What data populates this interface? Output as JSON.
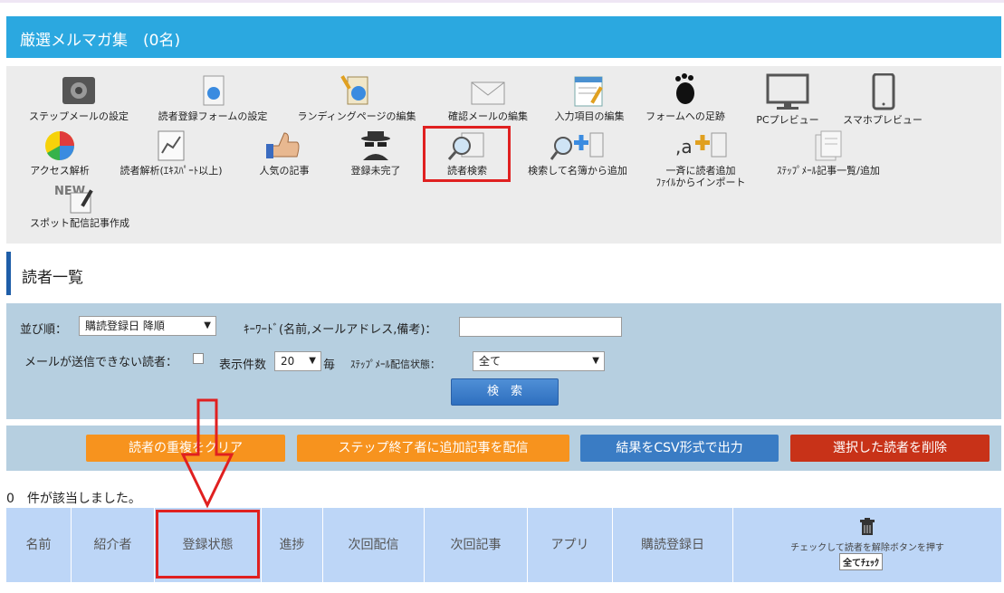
{
  "header": {
    "title": "厳選メルマガ集　(0名)",
    "color": "#2ba8e0"
  },
  "menu": [
    {
      "label": "ステップメールの設定",
      "icon": "settings-box-icon"
    },
    {
      "label": "読者登録フォームの設定",
      "icon": "form-document-icon"
    },
    {
      "label": "ランディングページの編集",
      "icon": "page-globe-icon"
    },
    {
      "label": "確認メールの編集",
      "icon": "envelope-icon"
    },
    {
      "label": "入力項目の編集",
      "icon": "edit-form-icon"
    },
    {
      "label": "フォームへの足跡",
      "icon": "footprint-icon"
    },
    {
      "label": "PCプレビュー",
      "icon": "monitor-icon"
    },
    {
      "label": "スマホプレビュー",
      "icon": "smartphone-icon"
    },
    {
      "label": "アクセス解析",
      "icon": "pie-chart-icon"
    },
    {
      "label": "読者解析(ｴｷｽﾊﾟｰﾄ以上)",
      "icon": "analysis-chart-icon"
    },
    {
      "label": "人気の記事",
      "icon": "thumbs-up-icon"
    },
    {
      "label": "登録未完了",
      "icon": "spy-icon"
    },
    {
      "label": "読者検索",
      "icon": "search-news-icon"
    },
    {
      "label": "検索して名簿から追加",
      "icon": "search-add-icon"
    },
    {
      "label": "一斉に読者追加",
      "label2": "ﾌｧｲﾙからインポート",
      "icon": "bulk-add-icon"
    },
    {
      "label": "ｽﾃｯﾌﾟﾒｰﾙ記事一覧/追加",
      "icon": "article-list-icon"
    },
    {
      "label": "スポット配信記事作成",
      "icon": "new-article-icon"
    }
  ],
  "section": {
    "title": "読者一覧"
  },
  "search": {
    "sort_label": "並び順：",
    "sort_value": "購読登録日 降順",
    "keyword_label": "ｷｰﾜｰﾄﾞ(名前,メールアドレス,備考)：",
    "keyword_value": "",
    "undeliverable_label": "メールが送信できない読者：",
    "per_page_label": "表示件数",
    "per_page_value": "20",
    "per_page_suffix": "毎",
    "status_label": "ｽﾃｯﾌﾟﾒｰﾙ配信状態：",
    "status_value": "全て",
    "search_button": "検　索"
  },
  "actions": [
    {
      "label": "読者の重複をクリア",
      "color": "#f7931e"
    },
    {
      "label": "ステップ終了者に追加記事を配信",
      "color": "#f7931e"
    },
    {
      "label": "結果をCSV形式で出力",
      "color": "#3a7cc4"
    },
    {
      "label": "選択した読者を削除",
      "color": "#c83218"
    }
  ],
  "result": {
    "count_text": "0　件が該当しました。"
  },
  "table": {
    "columns": [
      "名前",
      "紹介者",
      "登録状態",
      "進捗",
      "次回配信",
      "次回記事",
      "アプリ",
      "購読登録日"
    ],
    "delete_hint": "チェックして読者を解除ボタンを押す",
    "check_all": "全てﾁｪｯｸ"
  }
}
